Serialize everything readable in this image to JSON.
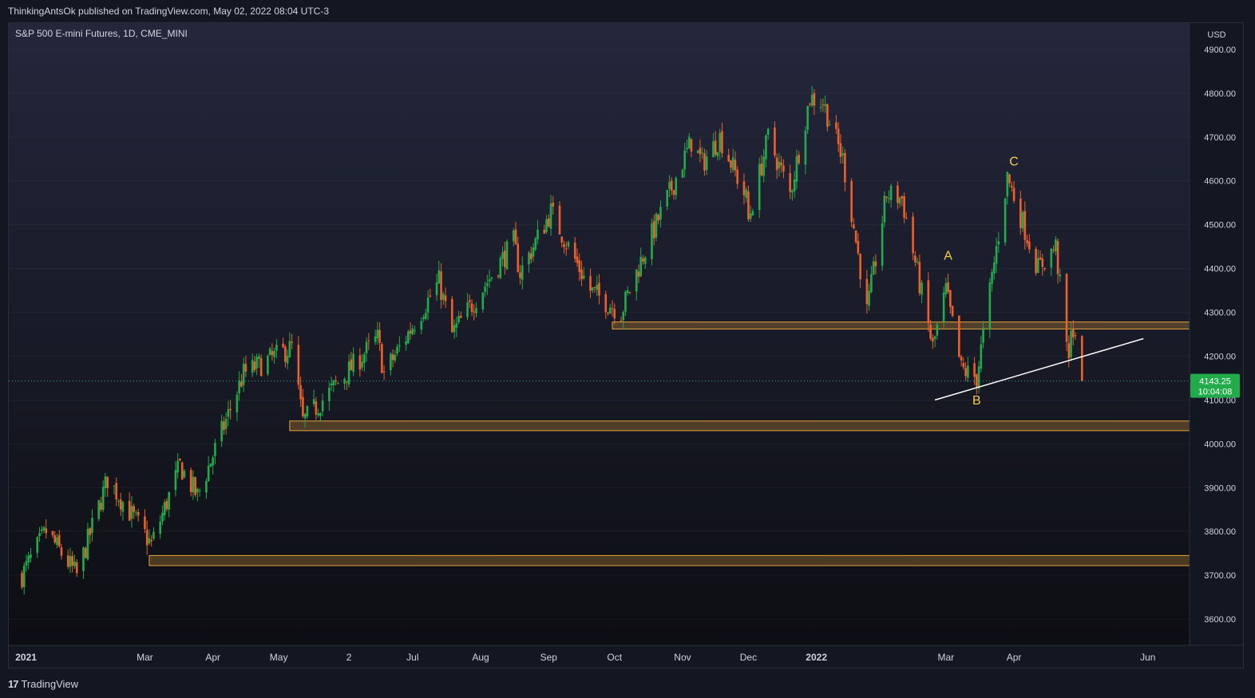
{
  "header": {
    "publisher_line": "ThinkingAntsOk published on TradingView.com, May 02, 2022 08:04 UTC-3"
  },
  "symbol_line": "S&P 500 E-mini Futures, 1D, CME_MINI",
  "footer": {
    "logo_mark": "17",
    "brand": "TradingView"
  },
  "colors": {
    "up": "#26a69a",
    "up_bright": "#22ab4b",
    "down": "#ef5f2a",
    "zone": "#e6a23c",
    "trend": "#ffffff",
    "label": "#f5d142"
  },
  "chart_data": {
    "type": "candlestick",
    "currency": "USD",
    "y_ticks": [
      3600,
      3700,
      3800,
      3900,
      4000,
      4100,
      4200,
      4300,
      4400,
      4500,
      4600,
      4700,
      4800,
      4900
    ],
    "y_tick_labels": [
      "3600.00",
      "3700.00",
      "3800.00",
      "3900.00",
      "4000.00",
      "4100.00",
      "4200.00",
      "4300.00",
      "4400.00",
      "4500.00",
      "4600.00",
      "4700.00",
      "4800.00",
      "4900.00"
    ],
    "ylim": [
      3540,
      4960
    ],
    "x_labels": [
      {
        "text": "2021",
        "date": "2021-01-01",
        "bold": true
      },
      {
        "text": "Mar",
        "date": "2021-03-01"
      },
      {
        "text": "Apr",
        "date": "2021-04-01"
      },
      {
        "text": "May",
        "date": "2021-05-01"
      },
      {
        "text": "2",
        "date": "2021-06-02"
      },
      {
        "text": "Jul",
        "date": "2021-07-01"
      },
      {
        "text": "Aug",
        "date": "2021-08-01"
      },
      {
        "text": "Sep",
        "date": "2021-09-01"
      },
      {
        "text": "Oct",
        "date": "2021-10-01"
      },
      {
        "text": "Nov",
        "date": "2021-11-01"
      },
      {
        "text": "Dec",
        "date": "2021-12-01"
      },
      {
        "text": "2022",
        "date": "2022-01-01",
        "bold": true
      },
      {
        "text": "Mar",
        "date": "2022-03-01"
      },
      {
        "text": "Apr",
        "date": "2022-04-01"
      },
      {
        "text": "Jun",
        "date": "2022-06-01"
      }
    ],
    "xlim": [
      "2020-12-29",
      "2022-06-20"
    ],
    "last_price": {
      "price_label": "4143.25",
      "value": 4143.25,
      "countdown": "10:04:08"
    },
    "zones": [
      {
        "start": "2021-09-30",
        "end": "2022-06-20",
        "low": 4262,
        "high": 4278
      },
      {
        "start": "2021-05-06",
        "end": "2022-06-20",
        "low": 4030,
        "high": 4052
      },
      {
        "start": "2021-03-03",
        "end": "2022-06-20",
        "low": 3722,
        "high": 3745
      }
    ],
    "trendline": {
      "start": {
        "date": "2022-02-24",
        "value": 4100
      },
      "end": {
        "date": "2022-05-30",
        "value": 4240
      }
    },
    "wave_labels": [
      {
        "text": "A",
        "date": "2022-03-02",
        "value": 4420
      },
      {
        "text": "B",
        "date": "2022-03-15",
        "value": 4090
      },
      {
        "text": "C",
        "date": "2022-04-01",
        "value": 4635
      }
    ],
    "anchors": [
      {
        "date": "2021-01-04",
        "value": 3700
      },
      {
        "date": "2021-01-15",
        "value": 3800
      },
      {
        "date": "2021-01-29",
        "value": 3700
      },
      {
        "date": "2021-02-12",
        "value": 3920
      },
      {
        "date": "2021-03-04",
        "value": 3770
      },
      {
        "date": "2021-03-17",
        "value": 3950
      },
      {
        "date": "2021-03-25",
        "value": 3880
      },
      {
        "date": "2021-04-15",
        "value": 4160
      },
      {
        "date": "2021-05-07",
        "value": 4220
      },
      {
        "date": "2021-05-12",
        "value": 4050
      },
      {
        "date": "2021-06-15",
        "value": 4240
      },
      {
        "date": "2021-06-18",
        "value": 4160
      },
      {
        "date": "2021-07-13",
        "value": 4370
      },
      {
        "date": "2021-07-19",
        "value": 4250
      },
      {
        "date": "2021-08-16",
        "value": 4460
      },
      {
        "date": "2021-08-19",
        "value": 4390
      },
      {
        "date": "2021-09-02",
        "value": 4530
      },
      {
        "date": "2021-09-20",
        "value": 4350
      },
      {
        "date": "2021-10-04",
        "value": 4300
      },
      {
        "date": "2021-10-14",
        "value": 4430
      },
      {
        "date": "2021-11-05",
        "value": 4690
      },
      {
        "date": "2021-11-10",
        "value": 4640
      },
      {
        "date": "2021-11-18",
        "value": 4700
      },
      {
        "date": "2021-11-30",
        "value": 4560
      },
      {
        "date": "2021-12-01",
        "value": 4510
      },
      {
        "date": "2021-12-10",
        "value": 4700
      },
      {
        "date": "2021-12-20",
        "value": 4570
      },
      {
        "date": "2021-12-29",
        "value": 4790
      },
      {
        "date": "2022-01-04",
        "value": 4780
      },
      {
        "date": "2022-01-13",
        "value": 4650
      },
      {
        "date": "2022-01-21",
        "value": 4400
      },
      {
        "date": "2022-01-24",
        "value": 4300
      },
      {
        "date": "2022-02-02",
        "value": 4570
      },
      {
        "date": "2022-02-09",
        "value": 4560
      },
      {
        "date": "2022-02-23",
        "value": 4220
      },
      {
        "date": "2022-03-01",
        "value": 4350
      },
      {
        "date": "2022-03-08",
        "value": 4170
      },
      {
        "date": "2022-03-15",
        "value": 4150
      },
      {
        "date": "2022-03-29",
        "value": 4610
      },
      {
        "date": "2022-04-12",
        "value": 4400
      },
      {
        "date": "2022-04-20",
        "value": 4450
      },
      {
        "date": "2022-04-26",
        "value": 4180
      },
      {
        "date": "2022-04-27",
        "value": 4280
      },
      {
        "date": "2022-05-02",
        "value": 4143
      }
    ]
  }
}
